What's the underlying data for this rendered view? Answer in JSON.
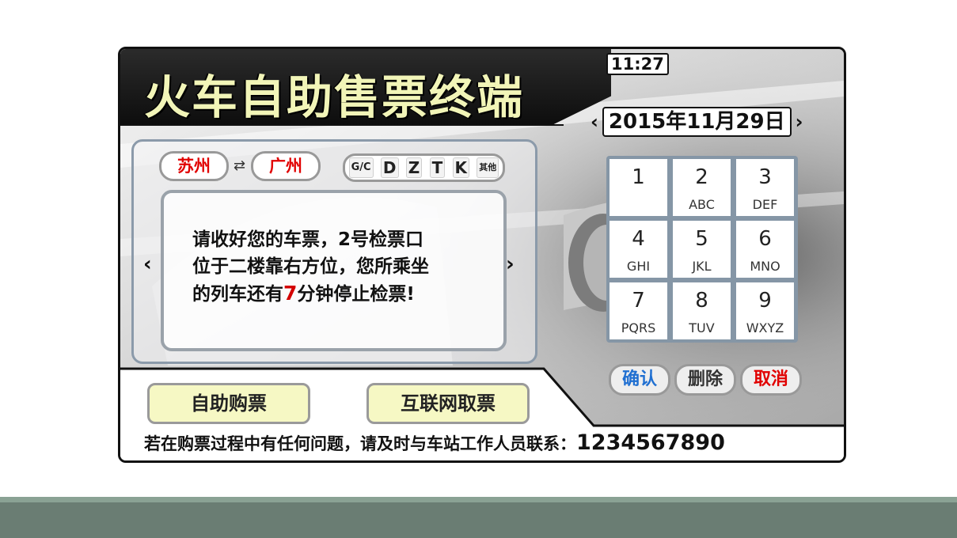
{
  "header": {
    "title": "火车自助售票终端",
    "clock": "11:27"
  },
  "date": {
    "prev": "‹",
    "value": "2015年11月29日",
    "next": "›"
  },
  "route": {
    "from": "苏州",
    "swap": "⇄",
    "to": "广州"
  },
  "train_types": [
    "G/C",
    "D",
    "Z",
    "T",
    "K",
    "其他"
  ],
  "message": {
    "line1": "请收好您的车票，2号检票口",
    "line2": "位于二楼靠右方位，您所乘坐",
    "line3_pre": "的列车还有",
    "minutes": "7",
    "line3_post": "分钟停止检票!",
    "prev": "‹",
    "next": "›"
  },
  "keypad": [
    {
      "digit": "1",
      "letters": ""
    },
    {
      "digit": "2",
      "letters": "ABC"
    },
    {
      "digit": "3",
      "letters": "DEF"
    },
    {
      "digit": "4",
      "letters": "GHI"
    },
    {
      "digit": "5",
      "letters": "JKL"
    },
    {
      "digit": "6",
      "letters": "MNO"
    },
    {
      "digit": "7",
      "letters": "PQRS"
    },
    {
      "digit": "8",
      "letters": "TUV"
    },
    {
      "digit": "9",
      "letters": "WXYZ"
    }
  ],
  "actions": {
    "confirm": "确认",
    "delete": "删除",
    "cancel": "取消"
  },
  "buttons": {
    "self_purchase": "自助购票",
    "internet_pickup": "互联网取票"
  },
  "footer": {
    "help_text": "若在购票过程中有任何问题，请及时与车站工作人员联系：",
    "phone": "1234567890"
  },
  "colors": {
    "title": "#f2f5b8",
    "station": "#e10000",
    "confirm": "#1f6fd1",
    "delete": "#333333",
    "cancel": "#e10000",
    "button_fill": "#f6f8c4",
    "keypad_bg": "#8596a6"
  }
}
